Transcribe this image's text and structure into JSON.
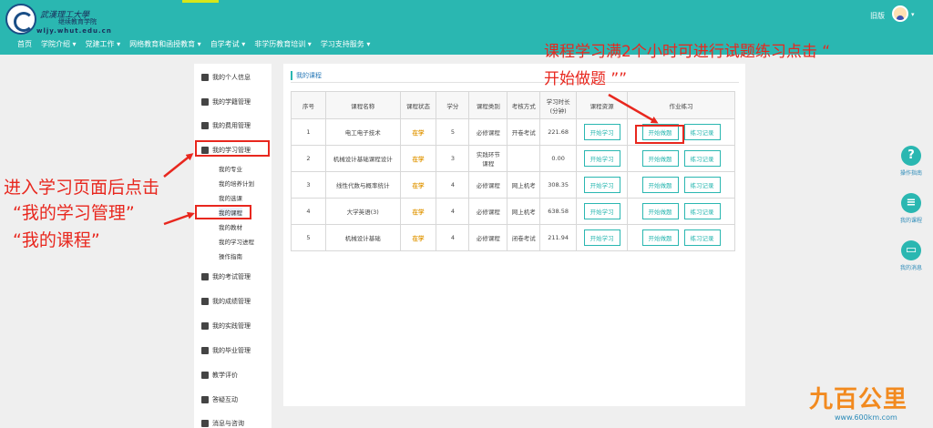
{
  "header": {
    "logo_cn": "武漢理工大學",
    "logo_sub": "继续教育学院",
    "logo_url": "wljy.whut.edu.cn",
    "user_name": "旧版",
    "nav": [
      "首页",
      "学院介绍 ▾",
      "党建工作 ▾",
      "网络教育和函授教育 ▾",
      "自学考试 ▾",
      "非学历教育培训 ▾",
      "学习支持服务 ▾"
    ]
  },
  "sidebar": {
    "items": [
      {
        "label": "我的个人信息"
      },
      {
        "label": "我的学籍管理"
      },
      {
        "label": "我的费用管理"
      },
      {
        "label": "我的学习管理"
      },
      {
        "label": "我的考试管理"
      },
      {
        "label": "我的成绩管理"
      },
      {
        "label": "我的实践管理"
      },
      {
        "label": "我的毕业管理"
      },
      {
        "label": "教学评价"
      },
      {
        "label": "答疑互动"
      },
      {
        "label": "消息与咨询"
      }
    ],
    "subs": [
      "我的专业",
      "我的培养计划",
      "我的选课",
      "我的课程",
      "我的教材",
      "我的学习进程",
      "操作指南"
    ]
  },
  "main": {
    "title": "我的课程",
    "headers": [
      "序号",
      "课程名称",
      "课程状态",
      "学分",
      "课程类别",
      "考核方式",
      "学习时长\n(分钟)",
      "课程资源",
      "作业练习"
    ],
    "rows": [
      {
        "no": "1",
        "name": "电工电子技术",
        "status": "在学",
        "credit": "5",
        "type": "必修课程",
        "exam": "开卷考试",
        "time": "221.68"
      },
      {
        "no": "2",
        "name": "机械设计基础课程设计",
        "status": "在学",
        "credit": "3",
        "type": "实践环节课程",
        "exam": "",
        "time": "0.00"
      },
      {
        "no": "3",
        "name": "线性代数与概率统计",
        "status": "在学",
        "credit": "4",
        "type": "必修课程",
        "exam": "网上机考",
        "time": "308.35"
      },
      {
        "no": "4",
        "name": "大学英语(3)",
        "status": "在学",
        "credit": "4",
        "type": "必修课程",
        "exam": "网上机考",
        "time": "638.58"
      },
      {
        "no": "5",
        "name": "机械设计基础",
        "status": "在学",
        "credit": "4",
        "type": "必修课程",
        "exam": "闭卷考试",
        "time": "211.94"
      }
    ],
    "btn_study": "开始学习",
    "btn_exercise": "开始做题",
    "btn_record": "练习记录"
  },
  "annotations": {
    "right_line1": "课程学习满2个小时可进行试题练习点击 “",
    "right_line2": "开始做题 ””",
    "left_line1": "进入学习页面后点击",
    "left_line2": "“我的学习管理”",
    "left_line3": "“我的课程”"
  },
  "right_float": [
    "操作指南",
    "我的课程",
    "我的消息"
  ],
  "watermark": {
    "text": "九百公里",
    "url": "www.600km.com"
  }
}
